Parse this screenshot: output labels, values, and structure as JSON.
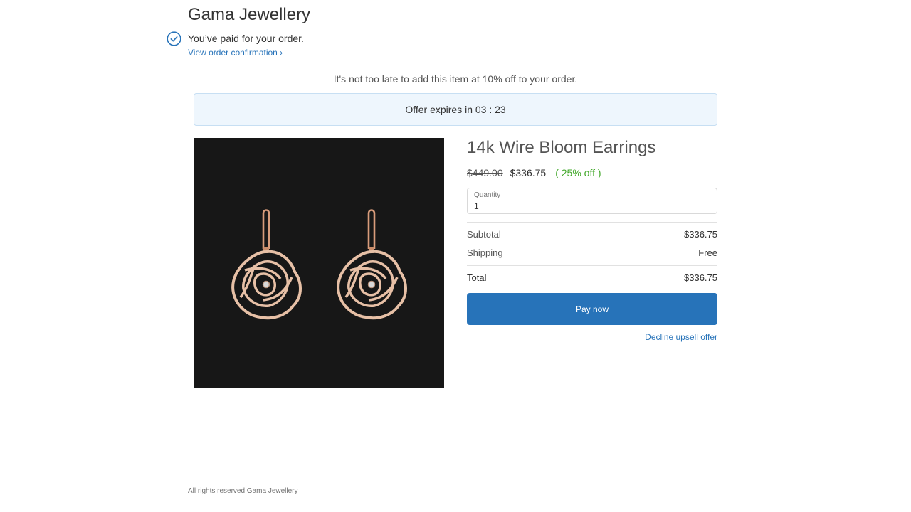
{
  "header": {
    "store_name": "Gama Jewellery",
    "paid_message": "You’ve paid for your order.",
    "confirmation_link": "View order confirmation ›"
  },
  "upsell": {
    "message": "It's not too late to add this item at 10% off to your order.",
    "offer_timer": "Offer expires in 03 : 23"
  },
  "product": {
    "image_icon": "earrings-image",
    "title": "14k Wire Bloom Earrings",
    "original_price": "$449.00",
    "sale_price": "$336.75",
    "discount": "( 25% off )"
  },
  "quantity": {
    "label": "Quantity",
    "value": "1"
  },
  "summary": {
    "subtotal_label": "Subtotal",
    "subtotal_value": "$336.75",
    "shipping_label": "Shipping",
    "shipping_value": "Free",
    "total_label": "Total",
    "total_value": "$336.75"
  },
  "actions": {
    "pay_label": "Pay now",
    "decline_label": "Decline upsell offer"
  },
  "footer": {
    "text": "All rights reserved Gama Jewellery"
  },
  "colors": {
    "accent": "#2773b9",
    "discount": "#42a82a",
    "banner_bg": "#eef6fd",
    "image_bg": "#171717"
  }
}
